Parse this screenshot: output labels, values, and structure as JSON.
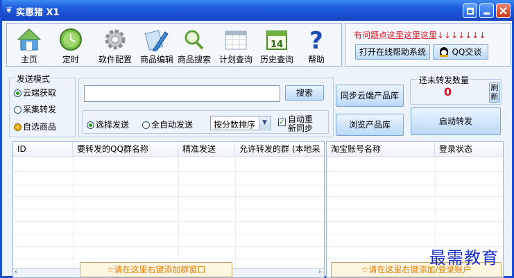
{
  "window": {
    "title": "实惠猪 X1"
  },
  "toolbar": {
    "items": [
      {
        "label": "主页",
        "icon": "home-icon"
      },
      {
        "label": "定时",
        "icon": "clock-icon"
      },
      {
        "label": "软件配置",
        "icon": "gear-icon"
      },
      {
        "label": "商品编辑",
        "icon": "pencil-icon"
      },
      {
        "label": "商品搜索",
        "icon": "magnifier-icon"
      },
      {
        "label": "计划查询",
        "icon": "calendar-grid-icon"
      },
      {
        "label": "历史查询",
        "icon": "calendar-14-icon"
      },
      {
        "label": "帮助",
        "icon": "question-icon"
      }
    ],
    "calendar_day": "14"
  },
  "help": {
    "notice": "有问题点这里这里这里↓↓↓↓↓↓↓",
    "online_help_button": "打开在线帮助系统",
    "qq_button": "QQ交谈"
  },
  "send_mode": {
    "legend": "发送模式",
    "options": [
      "云端获取",
      "采集转发",
      "自选商品"
    ],
    "selected": "云端获取"
  },
  "search": {
    "value": "",
    "button": "搜索"
  },
  "select_row": {
    "radio_select_send": "选择发送",
    "radio_auto_send": "全自动发送",
    "sort_value": "按分数排序",
    "auto_resync_line1": "自动重",
    "auto_resync_line2": "新同步",
    "auto_resync_checked": true
  },
  "actions": {
    "sync_cloud": "同步云端产品库",
    "browse_library": "浏览产品库",
    "start_forward": "启动转发"
  },
  "pending": {
    "legend": "还未转发数量",
    "count": "0",
    "refresh_line1": "刷",
    "refresh_line2": "新"
  },
  "groups_table": {
    "headers": [
      "ID",
      "要转发的QQ群名称",
      "精准发送",
      "允许转发的群 (本地采"
    ],
    "hint": "☆请在这里右键添加群窗口"
  },
  "accounts_table": {
    "headers": [
      "淘宝账号名称",
      "登录状态"
    ],
    "hint": "☆请在这里右键添加/登录账户"
  },
  "watermark": "最需教育",
  "colors": {
    "titlebar": "#1f5fe0",
    "notice_red": "#e0101a",
    "count_red": "#e0101a",
    "hint_orange": "#e37c00"
  }
}
